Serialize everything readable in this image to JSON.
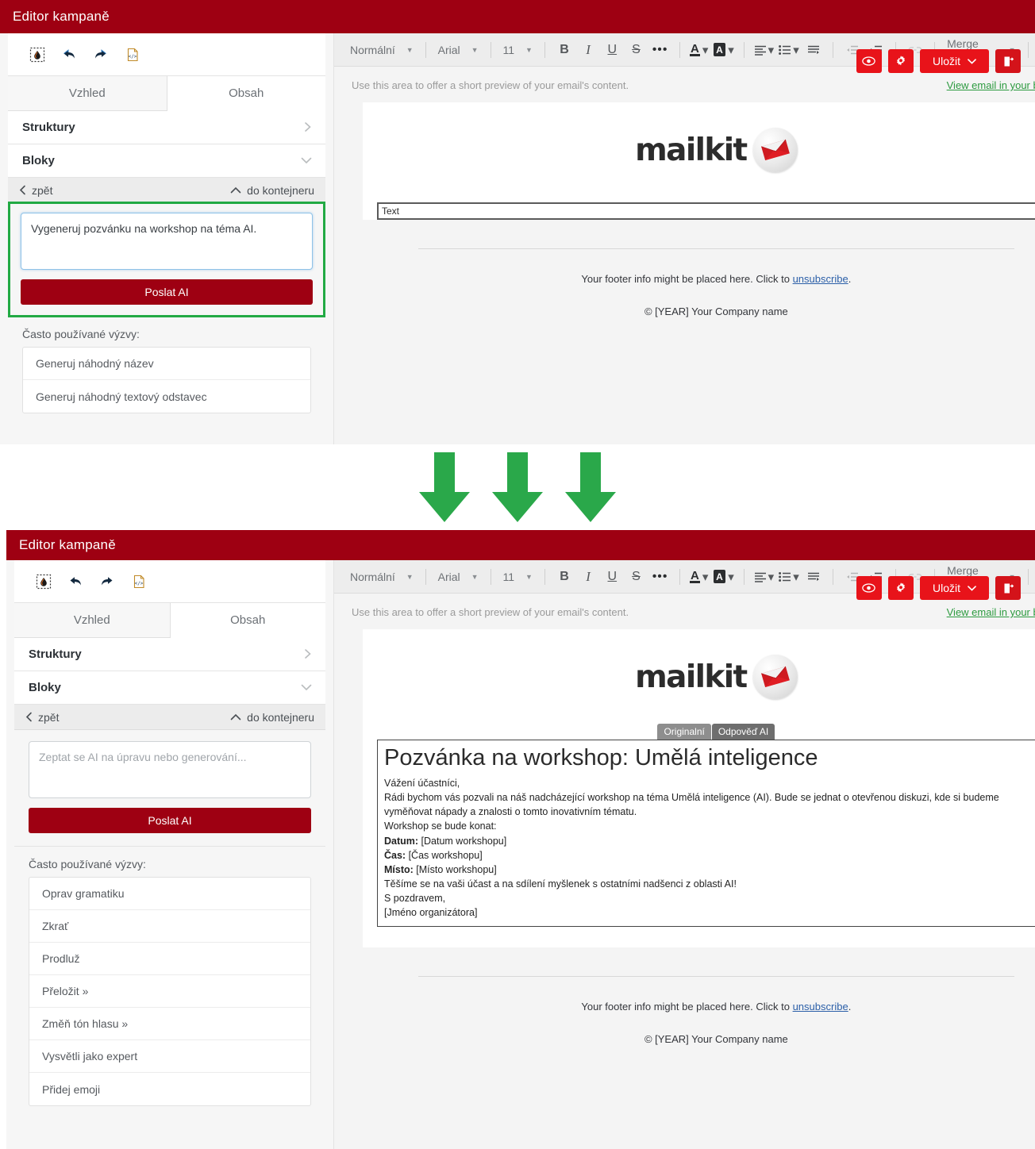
{
  "window": {
    "title": "Editor kampaně"
  },
  "toolbar": {
    "icons": [
      {
        "name": "selection-drop-icon",
        "title": "Vybrat"
      },
      {
        "name": "undo-icon",
        "title": "Zpět"
      },
      {
        "name": "redo-icon",
        "title": "Vpřed"
      },
      {
        "name": "source-code-icon",
        "title": "Zdrojový kód"
      }
    ],
    "actions": {
      "preview_label": "",
      "settings_label": "",
      "save_label": "Uložit",
      "exit_label": ""
    }
  },
  "sidebar": {
    "tabs": [
      {
        "label": "Vzhled",
        "active": false
      },
      {
        "label": "Obsah",
        "active": true
      }
    ],
    "accordions": [
      {
        "label": "Struktury",
        "state": "collapsed"
      },
      {
        "label": "Bloky",
        "state": "expanded"
      }
    ],
    "nav": {
      "back_label": "zpět",
      "container_label": "do kontejneru"
    },
    "prompts_heading": "Často používané výzvy:",
    "send_button": "Poslat AI"
  },
  "panel_top": {
    "ai_prompt_value": "Vygeneruj pozvánku na workshop na téma AI.",
    "ai_prompt_placeholder": "Zeptat se AI na úpravu nebo generování...",
    "prompts": [
      "Generuj náhodný název",
      "Generuj náhodný textový odstavec"
    ]
  },
  "panel_bottom": {
    "ai_prompt_value": "",
    "ai_prompt_placeholder": "Zeptat se AI na úpravu nebo generování...",
    "prompts": [
      "Oprav gramatiku",
      "Zkrať",
      "Prodluž",
      "Přeložit »",
      "Změň tón hlasu »",
      "Vysvětli jako expert",
      "Přidej emoji"
    ]
  },
  "rte": {
    "style_select": "Normální",
    "font_select": "Arial",
    "size_select": "11",
    "bold": "B",
    "italic": "I",
    "underline": "U",
    "strike": "S",
    "more": "•••",
    "font_color": "A",
    "highlight_color": "A",
    "merge_tags": "Merge tagy",
    "emoji": "😀",
    "overflow": "•••"
  },
  "email": {
    "preheader_text": "Use this area to offer a short preview of your email's content.",
    "view_in_browser": "View email in your browser",
    "logo_text": "mailkit",
    "text_block_value": "Text",
    "footer_text_before": "Your footer info might be placed here. Click to ",
    "footer_link": "unsubscribe",
    "footer_text_after": ".",
    "copyright": "© [YEAR] Your Company name"
  },
  "ai_response": {
    "tabs": [
      {
        "label": "Originalní",
        "selected": false
      },
      {
        "label": "Odpověď AI",
        "selected": true
      }
    ],
    "heading": "Pozvánka na workshop: Umělá inteligence",
    "lines": [
      {
        "text": "Vážení účastníci,"
      },
      {
        "text": "Rádi bychom vás pozvali na náš nadcházející workshop na téma Umělá inteligence (AI). Bude se jednat o otevřenou diskuzi, kde si budeme vyměňovat nápady a znalosti o tomto inovativním tématu."
      },
      {
        "text": "Workshop se bude konat:"
      },
      {
        "label": "Datum:",
        "text": " [Datum workshopu]"
      },
      {
        "label": "Čas:",
        "text": " [Čas workshopu]"
      },
      {
        "label": "Místo:",
        "text": " [Místo workshopu]"
      },
      {
        "text": "Těšíme se na vaši účast a na sdílení myšlenek s ostatními nadšenci z oblasti AI!"
      },
      {
        "text": "S pozdravem,"
      },
      {
        "text": "[Jméno organizátora]"
      }
    ]
  },
  "annotation": {
    "arrow_count": 3,
    "arrow_color": "#2aa84a",
    "highlight_color": "#22aa44"
  },
  "colors": {
    "titlebar": "#9e0012",
    "primary_button": "#9e0012",
    "action_button": "#e8131a",
    "link_green": "#2c9a3f",
    "link_blue": "#2b5fa8"
  }
}
